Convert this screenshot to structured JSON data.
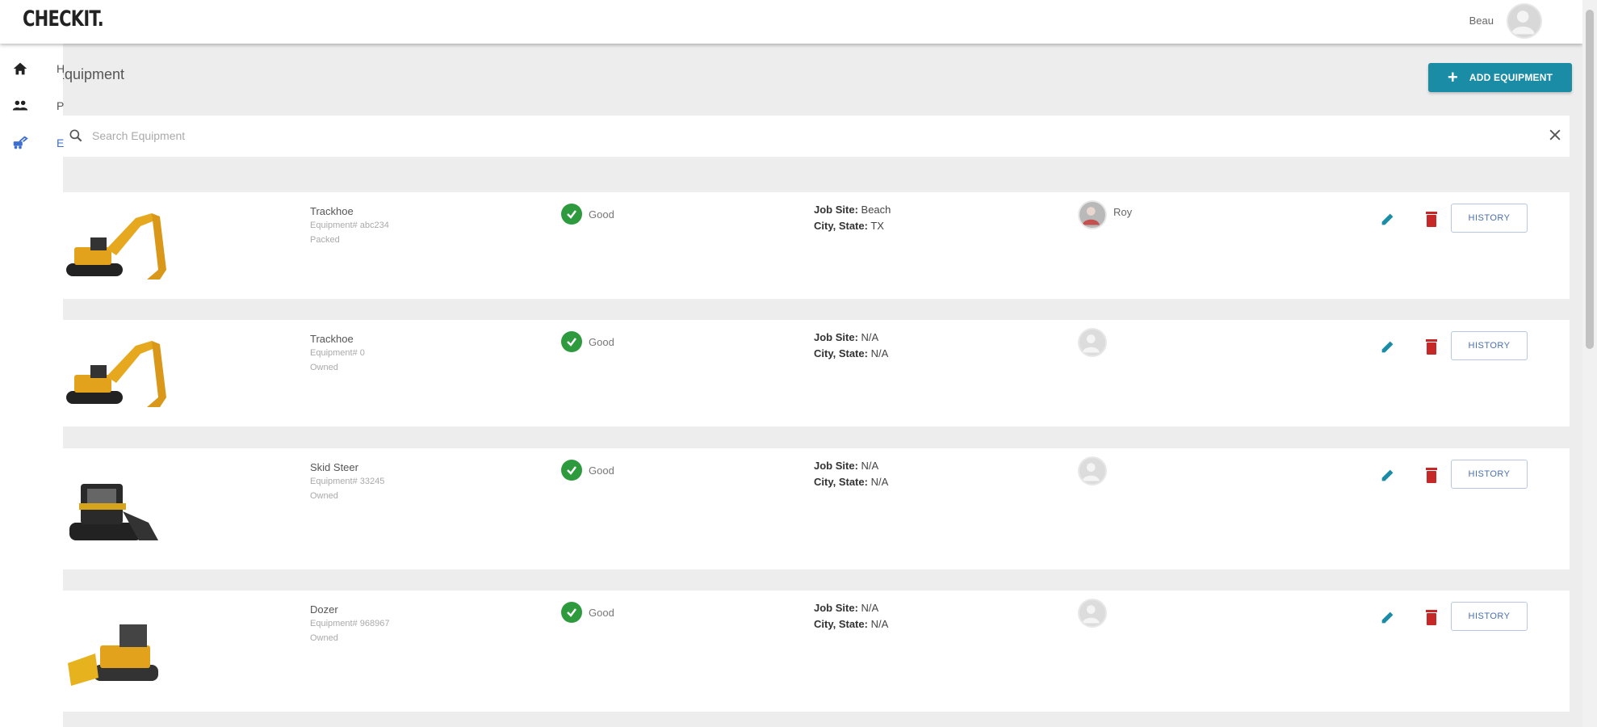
{
  "header": {
    "logo_text": "CHECKIT.",
    "user_name": "Beau"
  },
  "nav": {
    "items": [
      {
        "icon": "home-icon",
        "label": "H"
      },
      {
        "icon": "people-icon",
        "label": "P"
      },
      {
        "icon": "equipment-icon",
        "label": "E",
        "active": true
      }
    ]
  },
  "page": {
    "title": "Equipment",
    "add_button_label": "ADD EQUIPMENT",
    "accent_color": "#1a8ca6"
  },
  "search": {
    "placeholder": "Search Equipment",
    "value": ""
  },
  "rows": [
    {
      "image": "trackhoe",
      "name": "Trackhoe",
      "number": "Equipment# abc234",
      "state": "Packed",
      "condition": "Good",
      "job_site_label": "Job Site:",
      "job_site": "Beach",
      "city_state_label": "City, State:",
      "city_state": "TX",
      "assignee": "Roy",
      "history_label": "HISTORY"
    },
    {
      "image": "trackhoe",
      "name": "Trackhoe",
      "number": "Equipment# 0",
      "state": "Owned",
      "condition": "Good",
      "job_site_label": "Job Site:",
      "job_site": "N/A",
      "city_state_label": "City, State:",
      "city_state": "N/A",
      "assignee": "",
      "history_label": "HISTORY"
    },
    {
      "image": "skid-steer",
      "name": "Skid Steer",
      "number": "Equipment# 33245",
      "state": "Owned",
      "condition": "Good",
      "job_site_label": "Job Site:",
      "job_site": "N/A",
      "city_state_label": "City, State:",
      "city_state": "N/A",
      "assignee": "",
      "history_label": "HISTORY"
    },
    {
      "image": "dozer",
      "name": "Dozer",
      "number": "Equipment# 968967",
      "state": "Owned",
      "condition": "Good",
      "job_site_label": "Job Site:",
      "job_site": "N/A",
      "city_state_label": "City, State:",
      "city_state": "N/A",
      "assignee": "",
      "history_label": "HISTORY"
    }
  ]
}
